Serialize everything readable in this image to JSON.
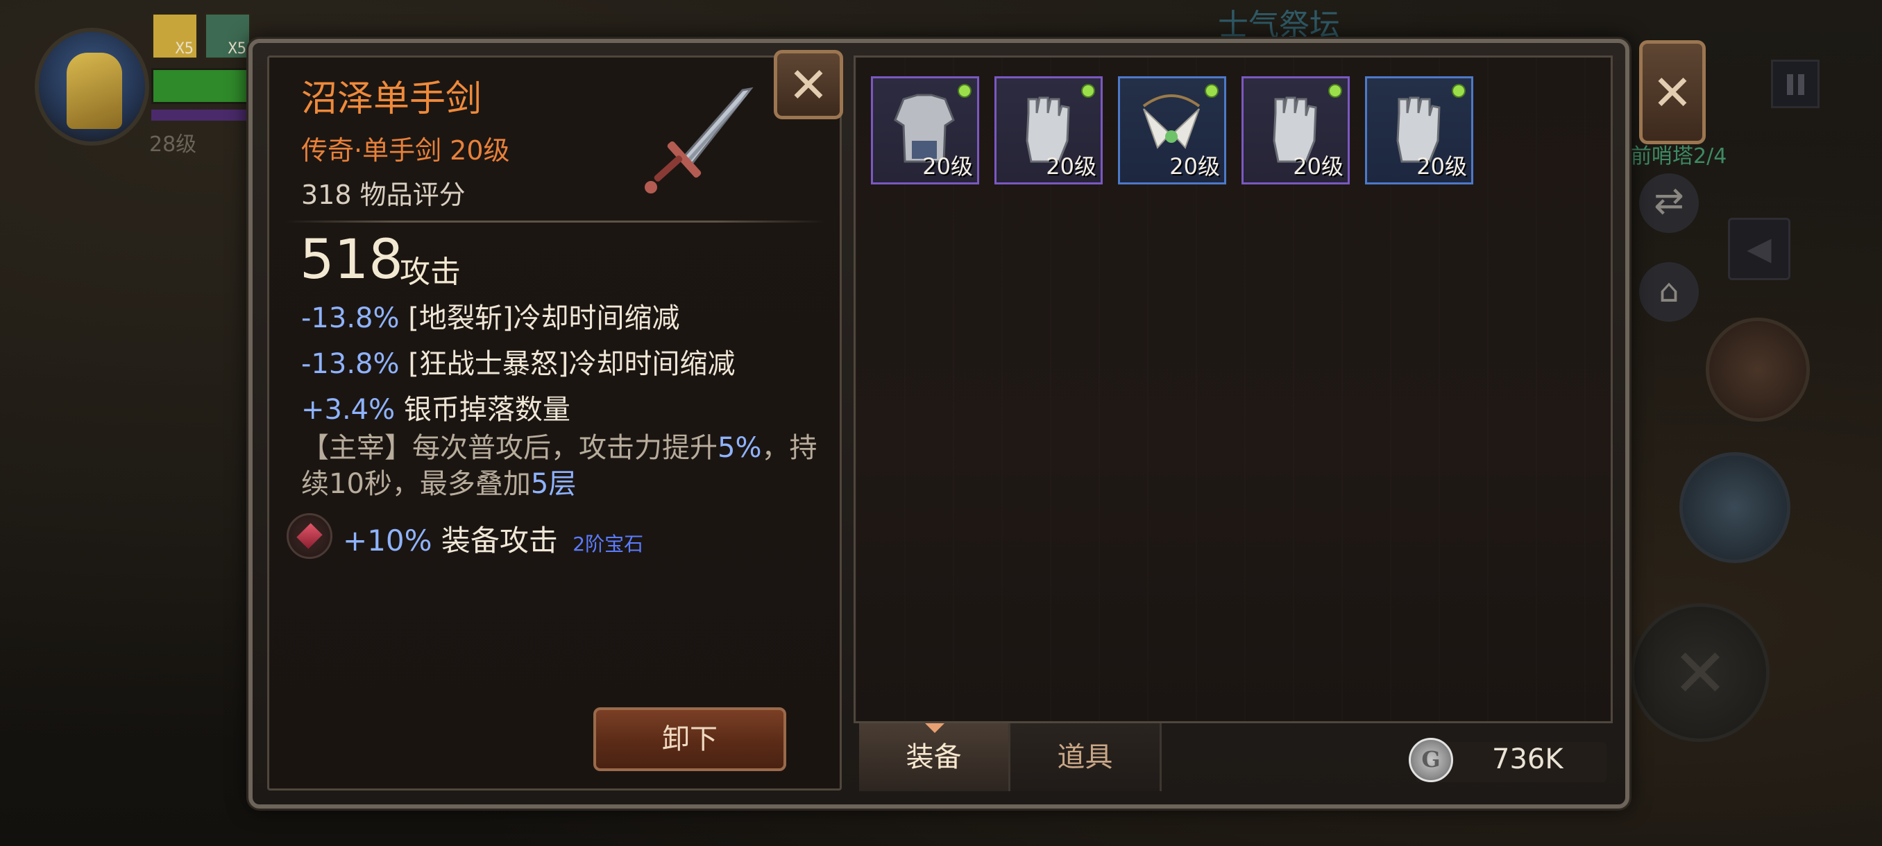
{
  "hud": {
    "player_level": "28级",
    "buff_counts": [
      "X5",
      "X5"
    ],
    "area_title": "士气祭坛",
    "quest_progress": "前哨塔2/4"
  },
  "item_detail": {
    "name": "沼泽单手剑",
    "subtitle": "传奇·单手剑 20级",
    "score": "318 物品评分",
    "attack_value": "518",
    "attack_label": "攻击",
    "stats": [
      {
        "value": "-13.8%",
        "text": "[地裂斩]冷却时间缩减"
      },
      {
        "value": "-13.8%",
        "text": "[狂战士暴怒]冷却时间缩减"
      },
      {
        "value": "+3.4%",
        "text": "银币掉落数量"
      }
    ],
    "passive": {
      "part1": "【主宰】每次普攻后，攻击力提升",
      "value1": "5%",
      "part2": "，持续10秒，最多叠加",
      "value2": "5层"
    },
    "gem": {
      "value": "+10%",
      "text": "装备攻击",
      "tier": "2阶宝石"
    },
    "unequip_label": "卸下",
    "close_label": "✕"
  },
  "inventory": {
    "close_label": "✕",
    "items": [
      {
        "icon": "armor-chest-icon",
        "level": "20级",
        "rarity": "epic"
      },
      {
        "icon": "gauntlet-icon",
        "level": "20级",
        "rarity": "epic"
      },
      {
        "icon": "amulet-icon",
        "level": "20级",
        "rarity": "rare"
      },
      {
        "icon": "gauntlet-icon",
        "level": "20级",
        "rarity": "epic"
      },
      {
        "icon": "gauntlet-icon",
        "level": "20级",
        "rarity": "rare"
      }
    ],
    "tabs": [
      {
        "label": "装备",
        "active": true
      },
      {
        "label": "道具",
        "active": false
      }
    ],
    "currency": {
      "icon": "silver-coin-icon",
      "value": "736K",
      "coin_glyph": "G"
    }
  },
  "colors": {
    "title_orange": "#ef8a3a",
    "stat_blue": "#8fb3ff",
    "epic_border": "#7b58c2",
    "rare_border": "#4d79c8",
    "new_dot": "#9be04a"
  }
}
